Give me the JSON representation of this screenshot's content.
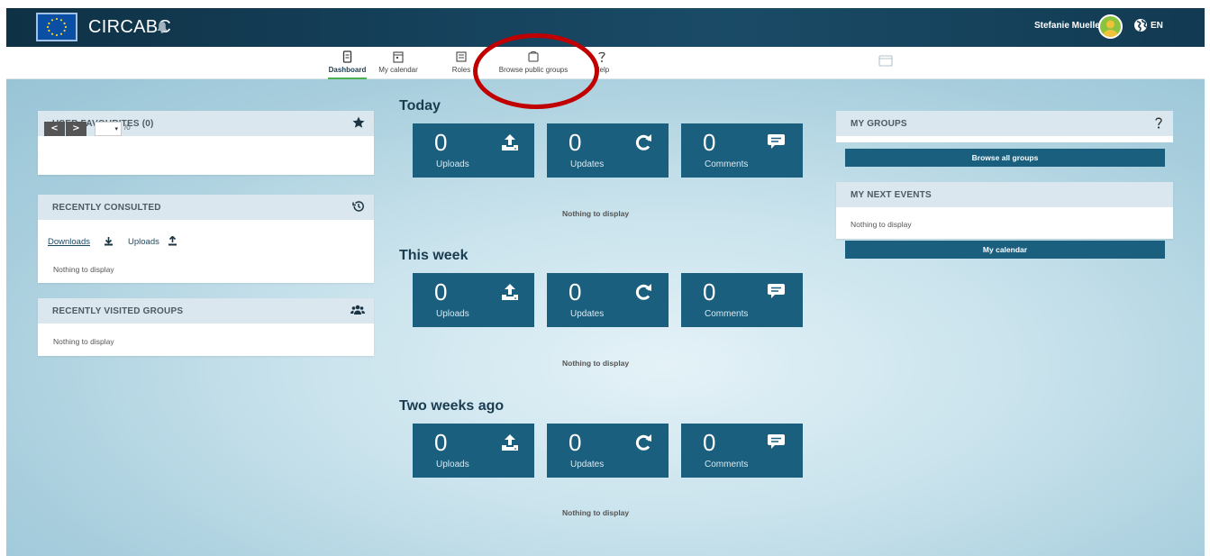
{
  "header": {
    "app_title": "CIRCABC",
    "user_name": "Stefanie Mueller",
    "language": "EN"
  },
  "nav": {
    "items": [
      {
        "label": "Dashboard",
        "icon": "dashboard-icon",
        "active": true
      },
      {
        "label": "My calendar",
        "icon": "calendar-icon",
        "active": false
      },
      {
        "label": "Roles",
        "icon": "roles-icon",
        "active": false
      },
      {
        "label": "Browse public groups",
        "icon": "browse-groups-icon",
        "active": false
      },
      {
        "label": "Help",
        "icon": "help-icon",
        "active": false
      }
    ]
  },
  "user_favourites": {
    "title": "USER FAVOURITES (0)",
    "prev_label": "<",
    "next_label": ">",
    "page_total": "/0"
  },
  "recently_consulted": {
    "title": "RECENTLY CONSULTED",
    "downloads_label": "Downloads",
    "uploads_label": "Uploads",
    "empty": "Nothing to display"
  },
  "recently_visited_groups": {
    "title": "RECENTLY VISITED GROUPS",
    "empty": "Nothing to display"
  },
  "activity": [
    {
      "title": "Today",
      "uploads": "0",
      "updates": "0",
      "comments": "0",
      "empty": "Nothing to display"
    },
    {
      "title": "This week",
      "uploads": "0",
      "updates": "0",
      "comments": "0",
      "empty": "Nothing to display"
    },
    {
      "title": "Two weeks ago",
      "uploads": "0",
      "updates": "0",
      "comments": "0",
      "empty": "Nothing to display"
    }
  ],
  "tile_labels": {
    "uploads": "Uploads",
    "updates": "Updates",
    "comments": "Comments"
  },
  "my_groups": {
    "title": "MY GROUPS",
    "browse_all_label": "Browse all groups"
  },
  "my_next_events": {
    "title": "MY NEXT EVENTS",
    "empty": "Nothing to display",
    "calendar_button": "My calendar"
  },
  "colors": {
    "tile": "#1a5f7e",
    "header": "#123a52",
    "annotation": "#c00000",
    "active_tab": "#4caf50"
  }
}
